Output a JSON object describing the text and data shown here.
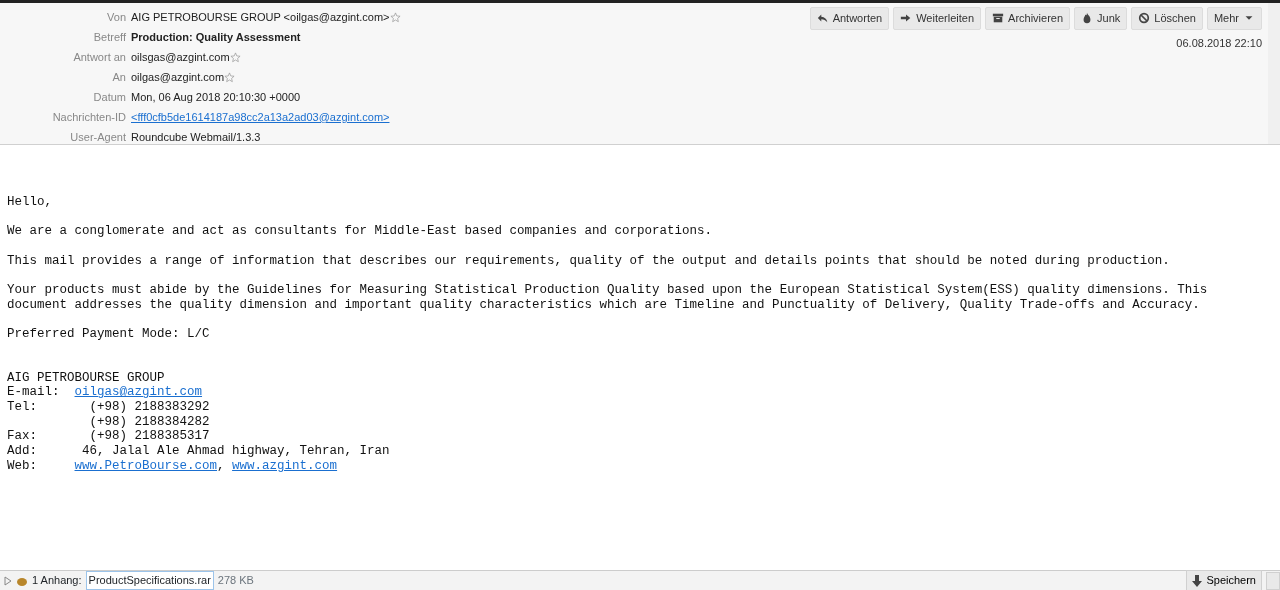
{
  "toolbar": {
    "buttons": [
      {
        "label": "Antworten"
      },
      {
        "label": "Weiterleiten"
      },
      {
        "label": "Archivieren"
      },
      {
        "label": "Junk"
      },
      {
        "label": "Löschen"
      },
      {
        "label": "Mehr"
      }
    ]
  },
  "header": {
    "date": "06.08.2018 22:10",
    "fields": [
      {
        "label": "Von",
        "value": "AIG PETROBOURSE GROUP <oilgas@azgint.com>",
        "kind": "text",
        "starred": true
      },
      {
        "label": "Betreff",
        "value": "Production: Quality Assessment",
        "kind": "bold",
        "starred": false
      },
      {
        "label": "Antwort an",
        "value": "oilsgas@azgint.com",
        "kind": "text",
        "starred": true
      },
      {
        "label": "An",
        "value": "oilgas@azgint.com",
        "kind": "text",
        "starred": true
      },
      {
        "label": "Datum",
        "value": "Mon, 06 Aug 2018 20:10:30 +0000",
        "kind": "text",
        "starred": false
      },
      {
        "label": "Nachrichten-ID",
        "value": "<fff0cfb5de1614187a98cc2a13a2ad03@azgint.com>",
        "kind": "link",
        "starred": false
      },
      {
        "label": "User-Agent",
        "value": "Roundcube Webmail/1.3.3",
        "kind": "text",
        "starred": false
      }
    ]
  },
  "body": {
    "paragraphs": [
      "Hello,",
      "We are a conglomerate and act as consultants for Middle-East based companies and corporations.",
      "This mail provides a range of information that describes our requirements, quality of the output and details points that should be noted during production.",
      "Your products must abide by the Guidelines for Measuring Statistical Production Quality based upon the European Statistical System(ESS) quality dimensions. This document addresses the quality dimension and important quality characteristics which are Timeline and Punctuality of Delivery, Quality Trade-offs and Accuracy.",
      "Preferred Payment Mode: L/C"
    ],
    "signature": [
      [
        {
          "text": "AIG PETROBOURSE GROUP",
          "link": false
        }
      ],
      [
        {
          "text": "E-mail:  ",
          "link": false
        },
        {
          "text": "oilgas@azgint.com",
          "link": true
        }
      ],
      [
        {
          "text": "Tel:       (+98) 2188383292",
          "link": false
        }
      ],
      [
        {
          "text": "           (+98) 2188384282",
          "link": false
        }
      ],
      [
        {
          "text": "Fax:       (+98) 2188385317",
          "link": false
        }
      ],
      [
        {
          "text": "Add:      46, Jalal Ale Ahmad highway, Tehran, Iran",
          "link": false
        }
      ],
      [
        {
          "text": "Web:     ",
          "link": false
        },
        {
          "text": "www.PetroBourse.com",
          "link": true
        },
        {
          "text": ", ",
          "link": false
        },
        {
          "text": "www.azgint.com",
          "link": true
        }
      ]
    ]
  },
  "attachments": {
    "summary": "1 Anhang:",
    "filename": "ProductSpecifications.rar",
    "size": "278 KB",
    "save": "Speichern"
  }
}
